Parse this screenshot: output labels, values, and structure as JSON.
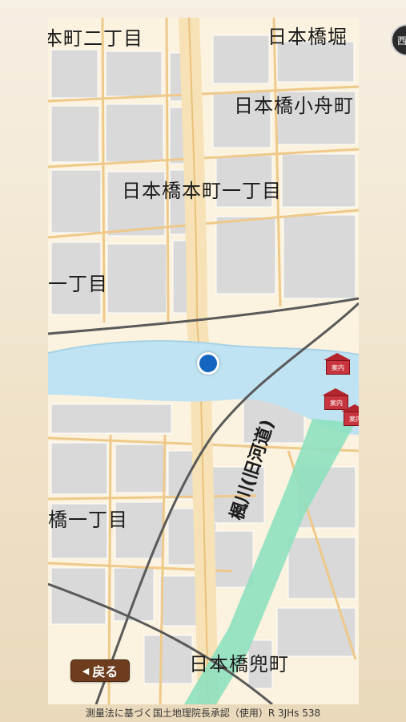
{
  "map": {
    "area_labels": {
      "nihonbashi_horidome": "日本橋堀",
      "honcho_2": "本町二丁目",
      "kobunacho": "日本橋小舟町",
      "honcho_1": "日本橋本町一丁目",
      "itchome_left": "一丁目",
      "bashi_itchome": "橋一丁目",
      "kabutocho": "日本橋兜町"
    },
    "river_label": "楓川(旧河道)",
    "poi_sign_text": "案内",
    "colors": {
      "water": "#bfe3f2",
      "river_old": "#8ee0bf",
      "road": "#f4d9a3",
      "block": "#d9d9d9",
      "rail": "#5a5a5a",
      "marker": "#1565c0",
      "poi": "#c8353e"
    }
  },
  "controls": {
    "back_label": "戻る",
    "back_icon": "triangle-left-icon"
  },
  "corner_badge_text": "西",
  "credit": "測量法に基づく国土地理院長承認（使用）R 3JHs 538"
}
